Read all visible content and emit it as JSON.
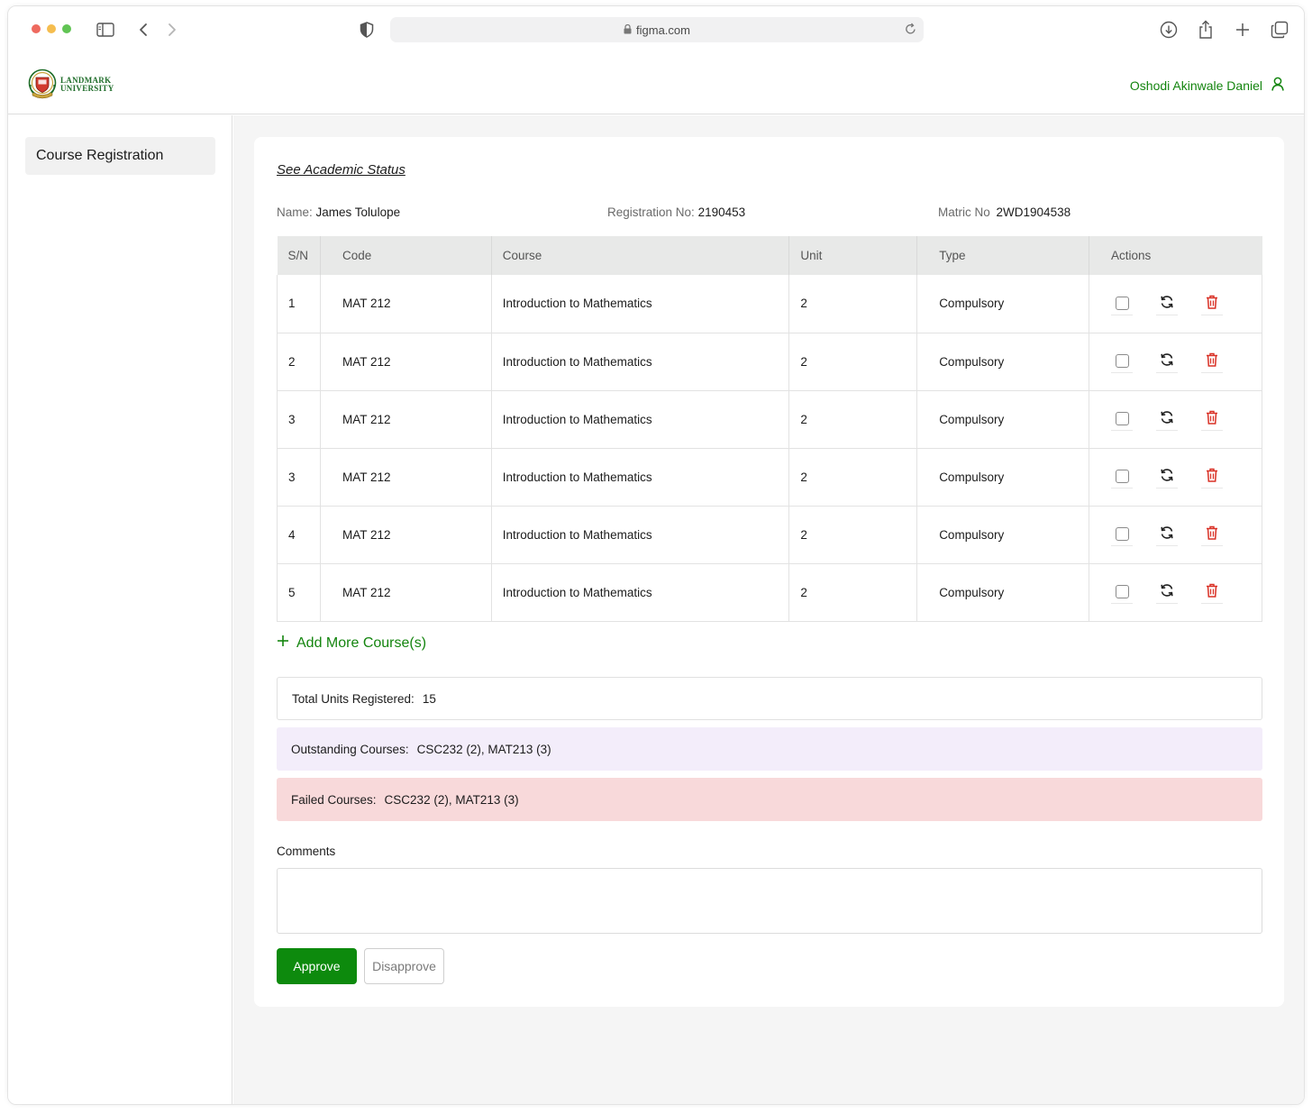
{
  "browser": {
    "url": "figma.com",
    "traffic_colors": [
      "#ee6a5f",
      "#f5bd4f",
      "#61c454"
    ]
  },
  "header": {
    "logo_line1": "LANDMARK",
    "logo_line2": "UNIVERSITY",
    "user_name": "Oshodi Akinwale Daniel"
  },
  "sidebar": {
    "items": [
      {
        "label": "Course Registration"
      }
    ]
  },
  "main": {
    "status_link": "See Academic Status",
    "student": {
      "name_label": "Name:",
      "name": "James Tolulope",
      "reg_label": "Registration No:",
      "reg_no": "2190453",
      "matric_label": "Matric No",
      "matric_no": "2WD1904538"
    },
    "table": {
      "headers": [
        "S/N",
        "Code",
        "Course",
        "Unit",
        "Type",
        "Actions"
      ],
      "rows": [
        {
          "sn": "1",
          "code": "MAT 212",
          "course": "Introduction to Mathematics",
          "unit": "2",
          "type": "Compulsory"
        },
        {
          "sn": "2",
          "code": "MAT 212",
          "course": "Introduction to Mathematics",
          "unit": "2",
          "type": "Compulsory"
        },
        {
          "sn": "3",
          "code": "MAT 212",
          "course": "Introduction to Mathematics",
          "unit": "2",
          "type": "Compulsory"
        },
        {
          "sn": "3",
          "code": "MAT 212",
          "course": "Introduction to Mathematics",
          "unit": "2",
          "type": "Compulsory"
        },
        {
          "sn": "4",
          "code": "MAT 212",
          "course": "Introduction to Mathematics",
          "unit": "2",
          "type": "Compulsory"
        },
        {
          "sn": "5",
          "code": "MAT 212",
          "course": "Introduction to Mathematics",
          "unit": "2",
          "type": "Compulsory"
        }
      ]
    },
    "add_more_label": "Add More Course(s)",
    "summary": {
      "total_label": "Total Units Registered:",
      "total_value": "15",
      "outstanding_label": "Outstanding Courses:",
      "outstanding_value": "CSC232 (2), MAT213 (3)",
      "failed_label": "Failed Courses:",
      "failed_value": "CSC232 (2), MAT213 (3)"
    },
    "comments_label": "Comments",
    "comments_value": "",
    "approve_label": "Approve",
    "disapprove_label": "Disapprove"
  },
  "colors": {
    "brand_green": "#0d8a0d",
    "link_green": "#14850f",
    "delete_red": "#d93025",
    "outstanding_bg": "#f3edfa",
    "failed_bg": "#f8d9da"
  }
}
